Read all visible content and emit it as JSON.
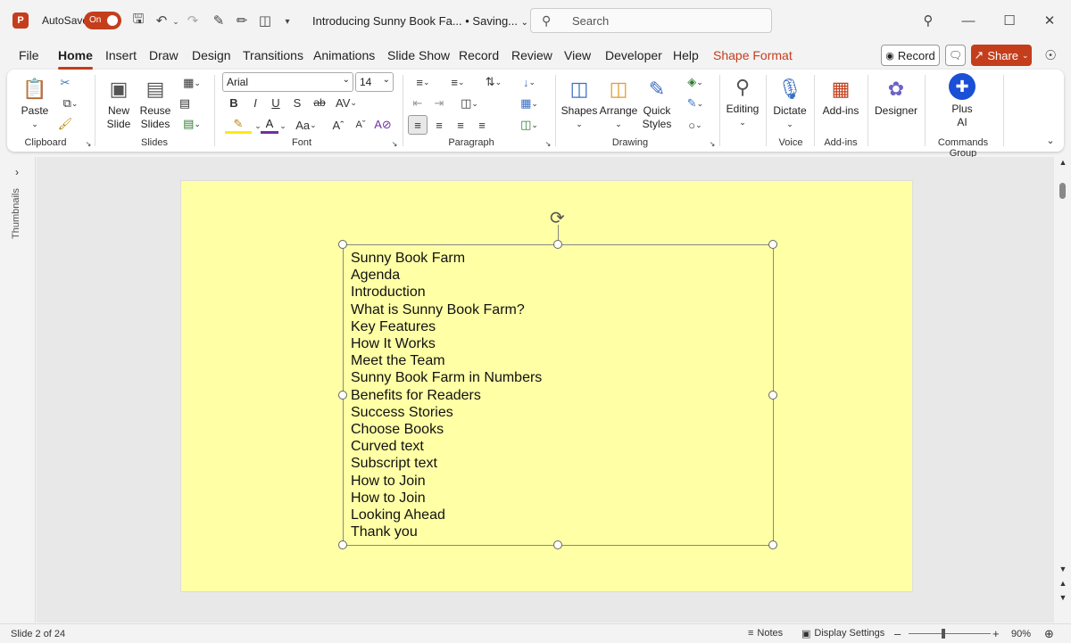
{
  "titlebar": {
    "autosave_label": "AutoSave",
    "autosave_state": "On",
    "doc_title": "Introducing Sunny Book Fa... • Saving...",
    "search_placeholder": "Search"
  },
  "tabs": [
    "File",
    "Home",
    "Insert",
    "Draw",
    "Design",
    "Transitions",
    "Animations",
    "Slide Show",
    "Record",
    "Review",
    "View",
    "Developer",
    "Help",
    "Shape Format"
  ],
  "tab_actions": {
    "record": "Record",
    "share": "Share"
  },
  "ribbon": {
    "clipboard": {
      "paste": "Paste",
      "label": "Clipboard"
    },
    "slides": {
      "new_slide": "New Slide",
      "reuse_slides": "Reuse Slides",
      "label": "Slides"
    },
    "font": {
      "name": "Arial",
      "size": "14",
      "label": "Font",
      "bold": "B",
      "italic": "I",
      "underline": "U",
      "shadow": "S",
      "strike": "ab",
      "aa": "Aa"
    },
    "paragraph": {
      "label": "Paragraph"
    },
    "drawing": {
      "shapes": "Shapes",
      "arrange": "Arrange",
      "quick_styles": "Quick Styles",
      "label": "Drawing"
    },
    "editing": {
      "label": "Editing"
    },
    "voice": {
      "dictate": "Dictate",
      "label": "Voice"
    },
    "addins": {
      "addins": "Add-ins",
      "label": "Add-ins"
    },
    "designer": {
      "label": "Designer"
    },
    "commands": {
      "plus_ai": "Plus AI",
      "label": "Commands Group"
    }
  },
  "thumbnails_label": "Thumbnails",
  "slide": {
    "lines": [
      "Sunny Book Farm",
      "Agenda",
      "Introduction",
      "What is Sunny Book Farm?",
      "Key Features",
      "How It Works",
      "Meet the Team",
      "Sunny Book Farm in Numbers",
      "Benefits for Readers",
      "Success Stories",
      "Choose Books",
      "Curved text",
      "Subscript text",
      "How to Join",
      "How to Join",
      "Looking Ahead",
      "Thank you"
    ],
    "background": "#ffffa6"
  },
  "status": {
    "slide_count": "Slide 2 of 24",
    "notes": "Notes",
    "display_settings": "Display Settings",
    "zoom": "90%"
  },
  "colors": {
    "accent": "#c43e1c"
  }
}
